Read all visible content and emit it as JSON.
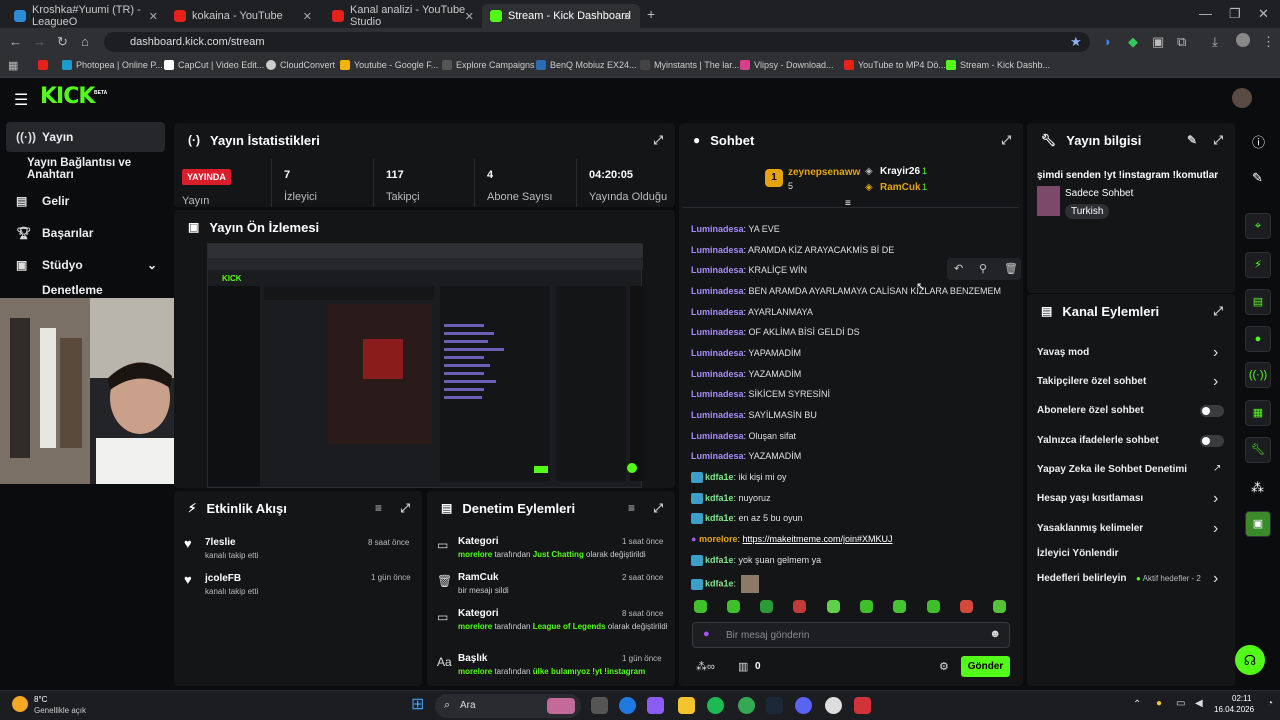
{
  "browser": {
    "tabs": [
      {
        "label": "Kroshka#Yuumi (TR) - LeagueO",
        "color": "#2b8bd6"
      },
      {
        "label": "kokaina - YouTube",
        "color": "#e62117"
      },
      {
        "label": "Kanal analizi - YouTube Studio",
        "color": "#e62117"
      },
      {
        "label": "Stream - Kick Dashboard",
        "color": "#53fc18"
      }
    ],
    "new_tab": "+",
    "url": "dashboard.kick.com/stream",
    "bookmarks": [
      "Photopea | Online P...",
      "CapCut | Video Edit...",
      "CloudConvert",
      "Youtube - Google F...",
      "Explore Campaigns",
      "BenQ Mobiuz EX24...",
      "Myinstants | The lar...",
      "Vlipsy - Download...",
      "YouTube to MP4 Dö...",
      "Stream - Kick Dashb..."
    ]
  },
  "kick": {
    "logo": "KICK",
    "beta": "BETA"
  },
  "sidebar": {
    "items": [
      "Yayın",
      "Yayın Bağlantısı ve Anahtarı",
      "Gelir",
      "Başarılar",
      "Stüdyo",
      "Denetleme"
    ]
  },
  "stats": {
    "title": "Yayın İstatistikleri",
    "live_badge": "YAYINDA",
    "live_label": "Yayın",
    "cells": [
      {
        "value": "7",
        "label": "İzleyici"
      },
      {
        "value": "117",
        "label": "Takipçi"
      },
      {
        "value": "4",
        "label": "Abone Sayısı"
      },
      {
        "value": "04:20:05",
        "label": "Yayında Olduğu"
      }
    ]
  },
  "preview": {
    "title": "Yayın Ön İzlemesi"
  },
  "activity": {
    "title": "Etkinlik Akışı",
    "items": [
      {
        "name": "7leslie",
        "sub": "kanalı takip etti",
        "time": "8 saat önce"
      },
      {
        "name": "jcoleFB",
        "sub": "kanalı takip etti",
        "time": "1 gün önce"
      }
    ]
  },
  "moderation": {
    "title": "Denetim Eylemleri",
    "items": [
      {
        "title": "Kategori",
        "actor": "morelore",
        "mid": " tarafından ",
        "target": "Just Chatting",
        "tail": " olarak değiştirildi",
        "time": "1 saat önce"
      },
      {
        "title": "RamCuk",
        "actor": "",
        "mid": "bir mesajı sildi",
        "target": "",
        "tail": "",
        "time": "2 saat önce"
      },
      {
        "title": "Kategori",
        "actor": "morelore",
        "mid": " tarafından ",
        "target": "League of Legends",
        "tail": " olarak değiştirildi",
        "time": "8 saat önce"
      },
      {
        "title": "Başlık",
        "actor": "morelore",
        "mid": " tarafından ",
        "target": "ülke bulamıyoz !yt !instagram",
        "tail": "",
        "time": "1 gün önce"
      }
    ]
  },
  "chat": {
    "title": "Sohbet",
    "leaders": [
      {
        "rank": "1",
        "name": "zeynepsenaww",
        "count": "5"
      },
      {
        "name": "Krayir26",
        "count": "1"
      },
      {
        "name": "RamCuk",
        "count": "1"
      }
    ],
    "messages": [
      {
        "user": "Luminadesa",
        "text": "YA EVE",
        "style": "p"
      },
      {
        "user": "Luminadesa",
        "text": "ARAMDA KİZ ARAYACAKMİS Bİ DE",
        "style": "p"
      },
      {
        "user": "Luminadesa",
        "text": "KRALİÇE WİN",
        "style": "p"
      },
      {
        "user": "Luminadesa",
        "text": "BEN ARAMDA AYARLAMAYA CALİSAN KIZLARA BENZEMEM",
        "style": "p"
      },
      {
        "user": "Luminadesa",
        "text": "AYARLANMAYA",
        "style": "p"
      },
      {
        "user": "Luminadesa",
        "text": "OF AKLİMA BİSİ GELDİ DS",
        "style": "p"
      },
      {
        "user": "Luminadesa",
        "text": "YAPAMADİM",
        "style": "p"
      },
      {
        "user": "Luminadesa",
        "text": "YAZAMADİM",
        "style": "p"
      },
      {
        "user": "Luminadesa",
        "text": "SİKİCEM SYRESİNİ",
        "style": "p"
      },
      {
        "user": "Luminadesa",
        "text": "SAYİLMASİN BU",
        "style": "p"
      },
      {
        "user": "Luminadesa",
        "text": "Oluşan sifat",
        "style": "p"
      },
      {
        "user": "Luminadesa",
        "text": "YAZAMADİM",
        "style": "p"
      },
      {
        "user": "kdfa1e",
        "text": "iki kişi mi oy",
        "style": "g"
      },
      {
        "user": "kdfa1e",
        "text": "nuyoruz",
        "style": "g"
      },
      {
        "user": "kdfa1e",
        "text": "en az 5 bu oyun",
        "style": "g"
      },
      {
        "user": "morelore",
        "text": "https://makeitmeme.com/join#XMKUJ",
        "style": "o"
      },
      {
        "user": "kdfa1e",
        "text": "yok şuan gelmem ya",
        "style": "g"
      },
      {
        "user": "kdfa1e",
        "text": "",
        "style": "g"
      }
    ],
    "input_placeholder": "Bir mesaj gönderin",
    "count": "0",
    "send": "Gönder"
  },
  "info": {
    "title": "Yayın bilgisi",
    "stream_title": "şimdi senden !yt !instagram !komutlar",
    "category": "Sadece Sohbet",
    "tag": "Turkish"
  },
  "channel_actions": {
    "title": "Kanal Eylemleri",
    "items": [
      {
        "label": "Yavaş mod",
        "ctl": "chev"
      },
      {
        "label": "Takipçilere özel sohbet",
        "ctl": "chev"
      },
      {
        "label": "Abonelere özel sohbet",
        "ctl": "tog"
      },
      {
        "label": "Yalnızca ifadelerle sohbet",
        "ctl": "tog"
      },
      {
        "label": "Yapay Zeka ile Sohbet Denetimi",
        "ctl": "ext"
      },
      {
        "label": "Hesap yaşı kısıtlaması",
        "ctl": "chev"
      },
      {
        "label": "Yasaklanmış kelimeler",
        "ctl": "chev"
      },
      {
        "label": "İzleyici Yönlendir",
        "ctl": ""
      },
      {
        "label": "Hedefleri belirleyin",
        "ctl": "chev"
      }
    ],
    "goals_active": "Aktif hedefler - 2"
  },
  "taskbar": {
    "temp": "8°C",
    "weather": "Genellikle açık",
    "search": "Ara",
    "time": "02:11",
    "date": "16.04.2026"
  }
}
